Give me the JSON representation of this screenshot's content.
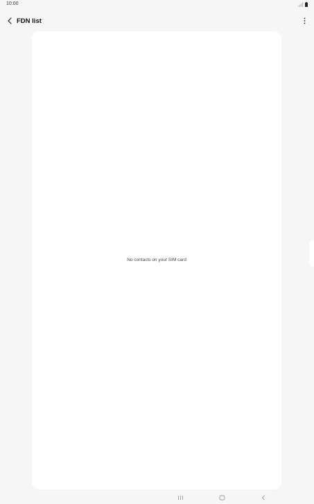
{
  "status_bar": {
    "time": "10:00",
    "icons": [
      "signal-icon",
      "battery-icon"
    ]
  },
  "app_bar": {
    "title": "FDN list",
    "back_icon": "chevron-left-icon",
    "more_icon": "more-vertical-icon"
  },
  "content": {
    "empty_message": "No contacts on your SIM card"
  },
  "nav_bar": {
    "buttons": [
      "recents-icon",
      "home-icon",
      "back-icon"
    ]
  },
  "colors": {
    "background": "#f6f6f6",
    "card": "#ffffff",
    "text": "#111111",
    "muted_text": "#444444"
  }
}
